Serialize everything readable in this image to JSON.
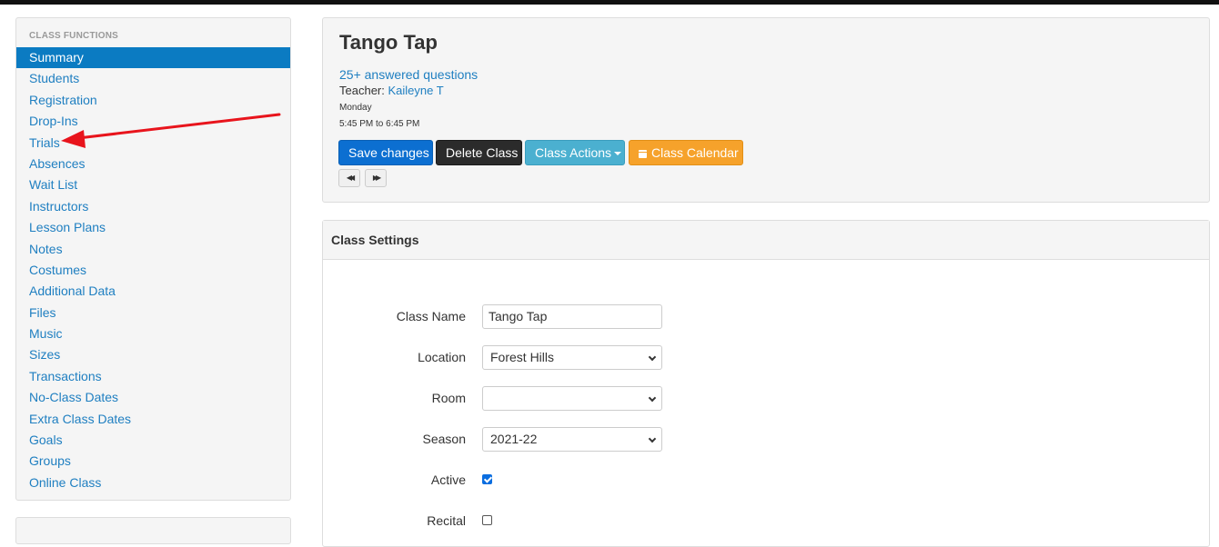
{
  "sidebar": {
    "header": "CLASS FUNCTIONS",
    "items": [
      {
        "label": "Summary",
        "active": true
      },
      {
        "label": "Students"
      },
      {
        "label": "Registration"
      },
      {
        "label": "Drop-Ins"
      },
      {
        "label": "Trials"
      },
      {
        "label": "Absences"
      },
      {
        "label": "Wait List"
      },
      {
        "label": "Instructors"
      },
      {
        "label": "Lesson Plans"
      },
      {
        "label": "Notes"
      },
      {
        "label": "Costumes"
      },
      {
        "label": "Additional Data"
      },
      {
        "label": "Files"
      },
      {
        "label": "Music"
      },
      {
        "label": "Sizes"
      },
      {
        "label": "Transactions"
      },
      {
        "label": "No-Class Dates"
      },
      {
        "label": "Extra Class Dates"
      },
      {
        "label": "Goals"
      },
      {
        "label": "Groups"
      },
      {
        "label": "Online Class"
      }
    ]
  },
  "class_header": {
    "title": "Tango Tap",
    "answered_questions": "25+ answered questions",
    "teacher_label": "Teacher: ",
    "teacher_name": "Kaileyne T",
    "day": "Monday",
    "time": "5:45 PM to 6:45 PM",
    "buttons": {
      "save": "Save changes",
      "delete": "Delete Class",
      "actions": "Class Actions",
      "calendar": "Class Calendar"
    },
    "nav": {
      "prev": "◀◀",
      "next": "▶▶"
    }
  },
  "settings": {
    "title": "Class Settings",
    "fields": {
      "class_name_label": "Class Name",
      "class_name_value": "Tango Tap",
      "location_label": "Location",
      "location_value": "Forest Hills",
      "room_label": "Room",
      "room_value": "",
      "season_label": "Season",
      "season_value": "2021-22",
      "active_label": "Active",
      "active_checked": true,
      "recital_label": "Recital",
      "recital_checked": false
    }
  },
  "colors": {
    "link": "#1f7fc1",
    "active_bg": "#0b7bc2",
    "save_btn": "#0c6fd1",
    "delete_btn": "#2b2b2b",
    "actions_btn": "#4bb0d0",
    "calendar_btn": "#f6a22b",
    "annotation_arrow": "#e8141c"
  },
  "icons": {
    "calendar": "calendar-icon",
    "caret": "caret-down-icon",
    "prev": "rewind-icon",
    "next": "fast-forward-icon"
  }
}
